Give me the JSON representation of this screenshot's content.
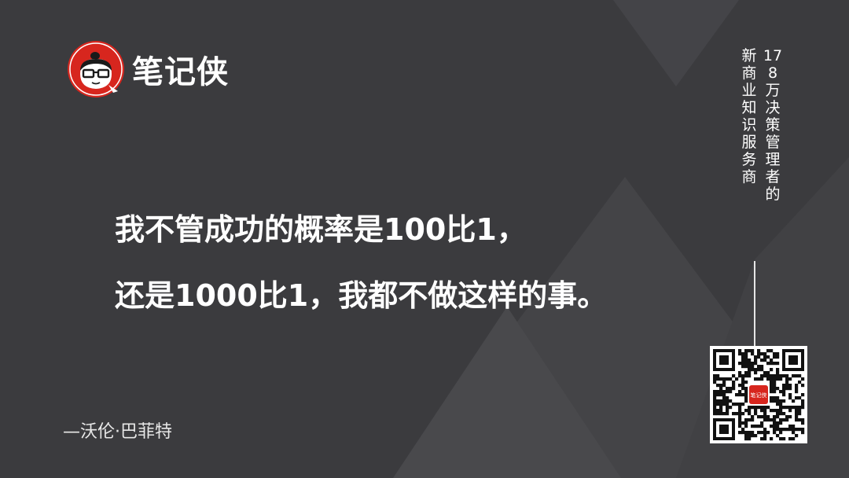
{
  "brand": {
    "name": "笔记侠",
    "logo_icon": "cartoon-face-logo-icon",
    "accent": "#d7261e"
  },
  "quote": {
    "line1": "我不管成功的概率是100比1，",
    "line2": "还是1000比1，我都不做这样的事。"
  },
  "author": "—沃伦·巴菲特",
  "tagline": {
    "col1": "178万决策管理者的",
    "col2": "新商业知识服务商"
  },
  "qr": {
    "icon": "qr-code-icon",
    "center_badge": "笔记侠"
  },
  "colors": {
    "background": "#3b3b3e",
    "text": "#ffffff"
  }
}
